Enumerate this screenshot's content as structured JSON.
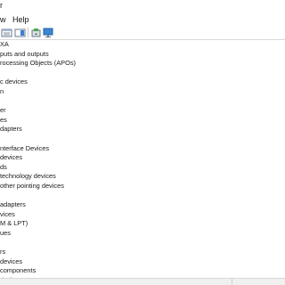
{
  "title": {
    "fragment": "r"
  },
  "menu": {
    "view_fragment": "w",
    "help": "Help"
  },
  "toolbar": {
    "buttons": [
      {
        "icon": "properties-grid-icon"
      },
      {
        "icon": "help-pane-icon"
      },
      {
        "icon": "update-driver-icon"
      },
      {
        "icon": "monitor-scan-icon"
      }
    ]
  },
  "tree": {
    "items": [
      "XA",
      "puts and outputs",
      "rocessing Objects (APOs)",
      "",
      "c devices",
      "n",
      "",
      "er",
      "es",
      "dapters",
      "",
      "nterface Devices",
      "devices",
      "ds",
      "technology devices",
      " other pointing devices",
      "",
      "adapters",
      "vices",
      "M & LPT)",
      "ues",
      "",
      "rs",
      "devices",
      " components",
      " devices"
    ]
  },
  "colors": {
    "background": "#ffffff",
    "toolbar_border": "#dadada",
    "status_bg": "#f0f0f0"
  }
}
